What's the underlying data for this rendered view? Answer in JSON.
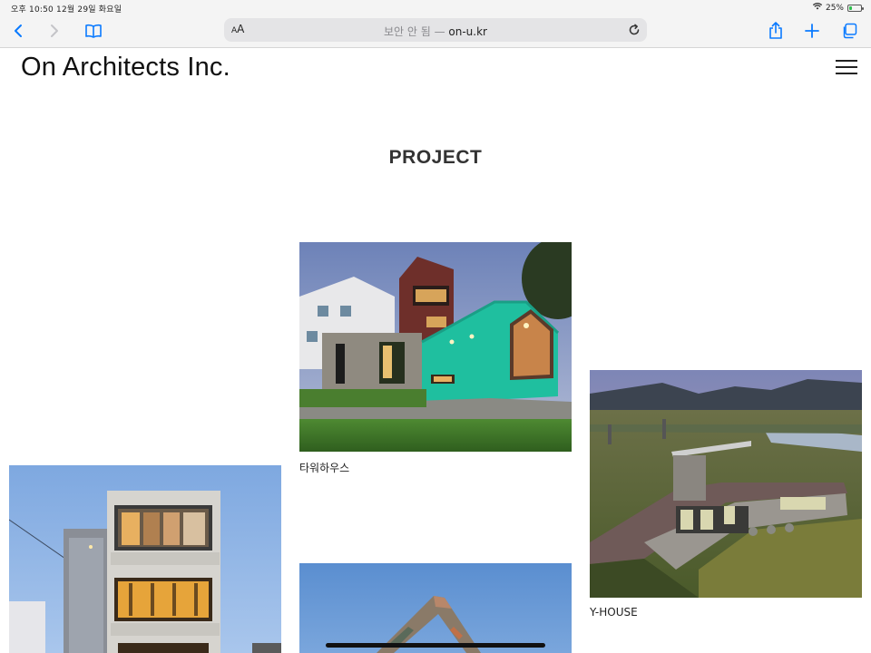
{
  "status_bar": {
    "time_date": "오후 10:50   12월 29일 화요일",
    "battery": "25%",
    "battery_level": 0.25
  },
  "browser": {
    "text_size_label": "AA",
    "url_prefix": "보안 안 됨 — ",
    "url_host": "on-u.kr"
  },
  "site": {
    "brand_prefix": "On",
    "brand_rest": " Architects Inc.",
    "section_title": "PROJECT"
  },
  "projects": [
    {
      "caption": "타워하우스"
    },
    {
      "caption": "Y-HOUSE"
    },
    {
      "caption": ""
    },
    {
      "caption": ""
    }
  ],
  "colors": {
    "safari_bar": "#f4f4f4",
    "address_field": "#e4e4e6",
    "safari_blue": "#0a7aff",
    "teal_cladding": "#1fbf9f"
  }
}
